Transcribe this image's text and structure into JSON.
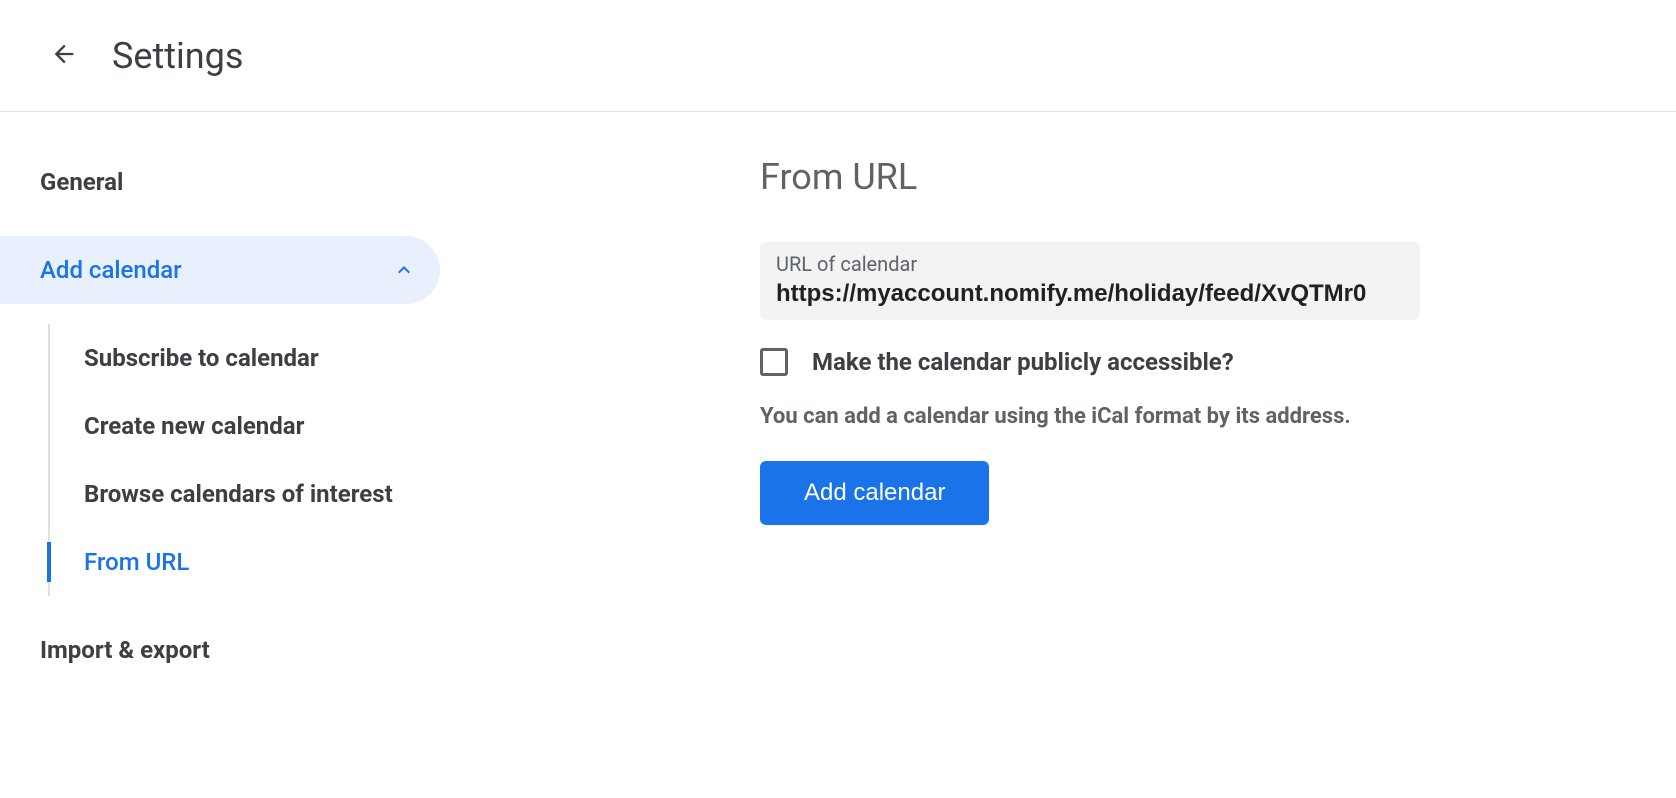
{
  "header": {
    "title": "Settings"
  },
  "sidebar": {
    "general_label": "General",
    "add_calendar_label": "Add calendar",
    "sub_items": {
      "subscribe": "Subscribe to calendar",
      "create_new": "Create new calendar",
      "browse": "Browse calendars of interest",
      "from_url": "From URL"
    },
    "import_export_label": "Import & export"
  },
  "main": {
    "section_title": "From URL",
    "url_input": {
      "label": "URL of calendar",
      "value": "https://myaccount.nomify.me/holiday/feed/XvQTMr0"
    },
    "checkbox_label": "Make the calendar publicly accessible?",
    "help_text": "You can add a calendar using the iCal format by its address.",
    "add_button_label": "Add calendar"
  }
}
